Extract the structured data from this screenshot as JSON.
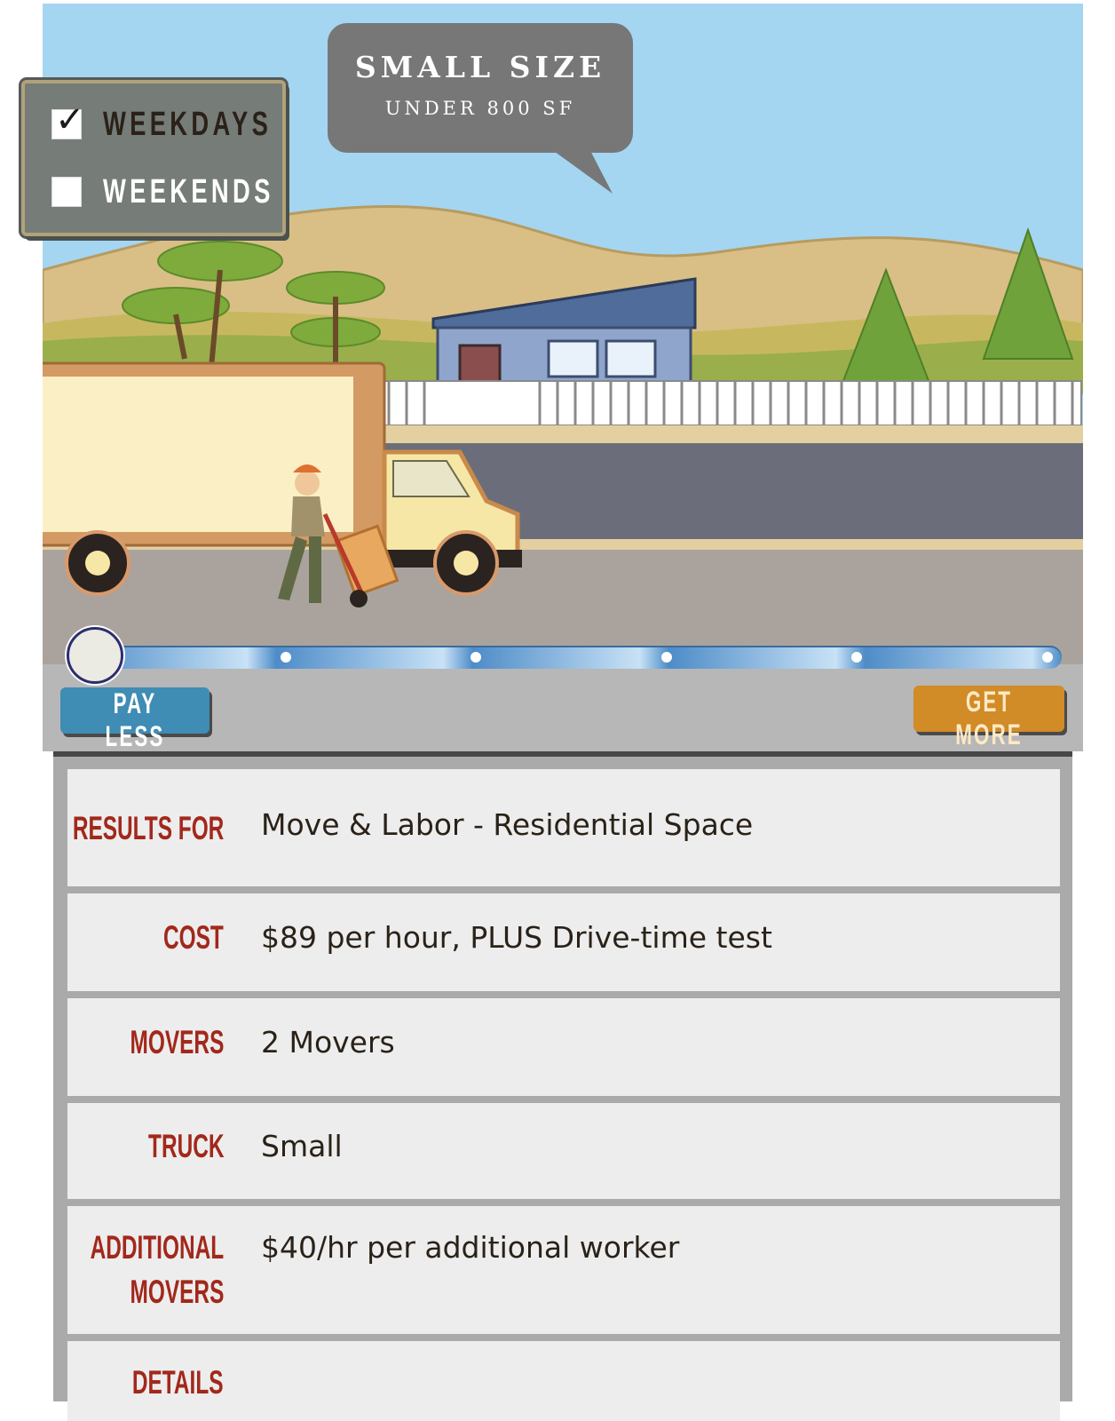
{
  "schedule": {
    "weekdays": {
      "label": "WEEKDAYS",
      "checked": true
    },
    "weekends": {
      "label": "WEEKENDS",
      "checked": false
    }
  },
  "size_bubble": {
    "title": "SMALL SIZE",
    "subtitle": "UNDER 800 SF"
  },
  "slider": {
    "position": 0,
    "steps": 6
  },
  "buttons": {
    "pay_less": "PAY LESS",
    "get_more": "GET MORE"
  },
  "results": {
    "rows": [
      {
        "label": "RESULTS FOR",
        "value": "Move & Labor - Residential Space"
      },
      {
        "label": "COST",
        "value": "$89 per hour, PLUS Drive-time test"
      },
      {
        "label": "MOVERS",
        "value": "2 Movers"
      },
      {
        "label": "TRUCK",
        "value": "Small"
      },
      {
        "label": "ADDITIONAL",
        "label2": "MOVERS",
        "value": "$40/hr per additional worker"
      },
      {
        "label": "DETAILS",
        "value": ""
      }
    ]
  },
  "colors": {
    "label_red": "#a2281b",
    "pay_less_blue": "#3f8cb4",
    "get_more_orange": "#d18b27"
  }
}
